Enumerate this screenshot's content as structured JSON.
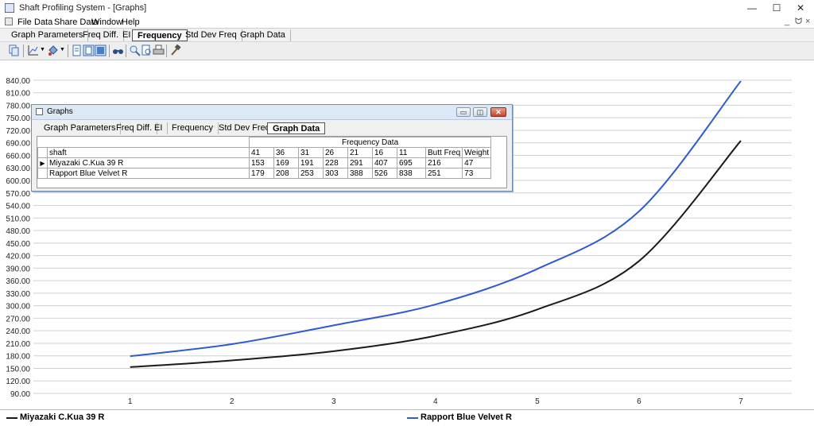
{
  "window": {
    "title": "Shaft Profiling System - [Graphs]",
    "minimize_glyph": "—",
    "maximize_glyph": "☐",
    "close_glyph": "✕",
    "mdi_min": "_",
    "mdi_restore": "ᗢ",
    "mdi_close": "×"
  },
  "menu": [
    "File",
    "Data",
    "Share Data",
    "Window",
    "Help"
  ],
  "tabs": [
    {
      "label": "Graph Parameters",
      "active": false
    },
    {
      "label": "Freq Diff.",
      "active": false
    },
    {
      "label": "EI",
      "active": false
    },
    {
      "label": "Frequency",
      "active": true
    },
    {
      "label": "Std Dev Freq",
      "active": false
    },
    {
      "label": "Graph Data",
      "active": false
    }
  ],
  "toolbar_icons": [
    "copy-icon",
    "axis-icon",
    "paint-icon",
    "page-icon",
    "page-blue-icon",
    "grid-icon",
    "binoculars-icon",
    "zoom-icon",
    "zoom-page-icon",
    "print-icon",
    "hammer-icon"
  ],
  "graphs_window": {
    "title": "Graphs",
    "tabs": [
      {
        "label": "Graph Parameters",
        "active": false
      },
      {
        "label": "Freq Diff.",
        "active": false
      },
      {
        "label": "EI",
        "active": false
      },
      {
        "label": "Frequency",
        "active": false
      },
      {
        "label": "Std Dev Freq",
        "active": false
      },
      {
        "label": "Graph Data",
        "active": true
      }
    ],
    "group_header": "Frequency Data",
    "columns": [
      "shaft",
      "41",
      "36",
      "31",
      "26",
      "21",
      "16",
      "11",
      "Butt Freq",
      "Weight"
    ],
    "rows": [
      {
        "selected": true,
        "cells": [
          "Miyazaki C.Kua 39 R",
          "153",
          "169",
          "191",
          "228",
          "291",
          "407",
          "695",
          "216",
          "47"
        ]
      },
      {
        "selected": false,
        "cells": [
          "Rapport Blue Velvet R",
          "179",
          "208",
          "253",
          "303",
          "388",
          "526",
          "838",
          "251",
          "73"
        ]
      }
    ]
  },
  "chart_data": {
    "type": "line",
    "x": [
      1,
      2,
      3,
      4,
      5,
      6,
      7
    ],
    "y_ticks": [
      "90.00",
      "120.00",
      "150.00",
      "180.00",
      "210.00",
      "240.00",
      "270.00",
      "300.00",
      "330.00",
      "360.00",
      "390.00",
      "420.00",
      "450.00",
      "480.00",
      "510.00",
      "540.00",
      "570.00",
      "600.00",
      "630.00",
      "660.00",
      "690.00",
      "720.00",
      "750.00",
      "780.00",
      "810.00",
      "840.00"
    ],
    "x_ticks": [
      "1",
      "2",
      "3",
      "4",
      "5",
      "6",
      "7"
    ],
    "ylim": [
      90,
      855
    ],
    "xlim": [
      0.05,
      7.5
    ],
    "grid": true,
    "legend_position": "bottom",
    "series": [
      {
        "name": "Miyazaki C.Kua 39 R",
        "color": "#1a1a1a",
        "values": [
          153,
          169,
          191,
          228,
          291,
          407,
          695
        ]
      },
      {
        "name": "Rapport Blue Velvet R",
        "color": "#2d5ccf",
        "values": [
          179,
          208,
          253,
          303,
          388,
          526,
          838
        ]
      }
    ]
  }
}
